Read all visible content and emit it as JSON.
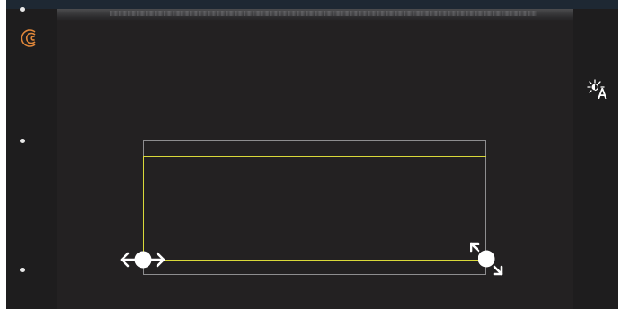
{
  "colors": {
    "background": "#1f1e1f",
    "image_area": "#232122",
    "roi_outer": "#8d8d8f",
    "roi_inner": "#d9d93a",
    "logo_accent": "#e0873a",
    "handle": "#ffffff"
  },
  "icons": {
    "logo": "butterfly-logo-icon",
    "brightness": "auto-brightness-icon",
    "move": "move-horizontal-handle-icon",
    "resize": "resize-diagonal-handle-icon"
  }
}
